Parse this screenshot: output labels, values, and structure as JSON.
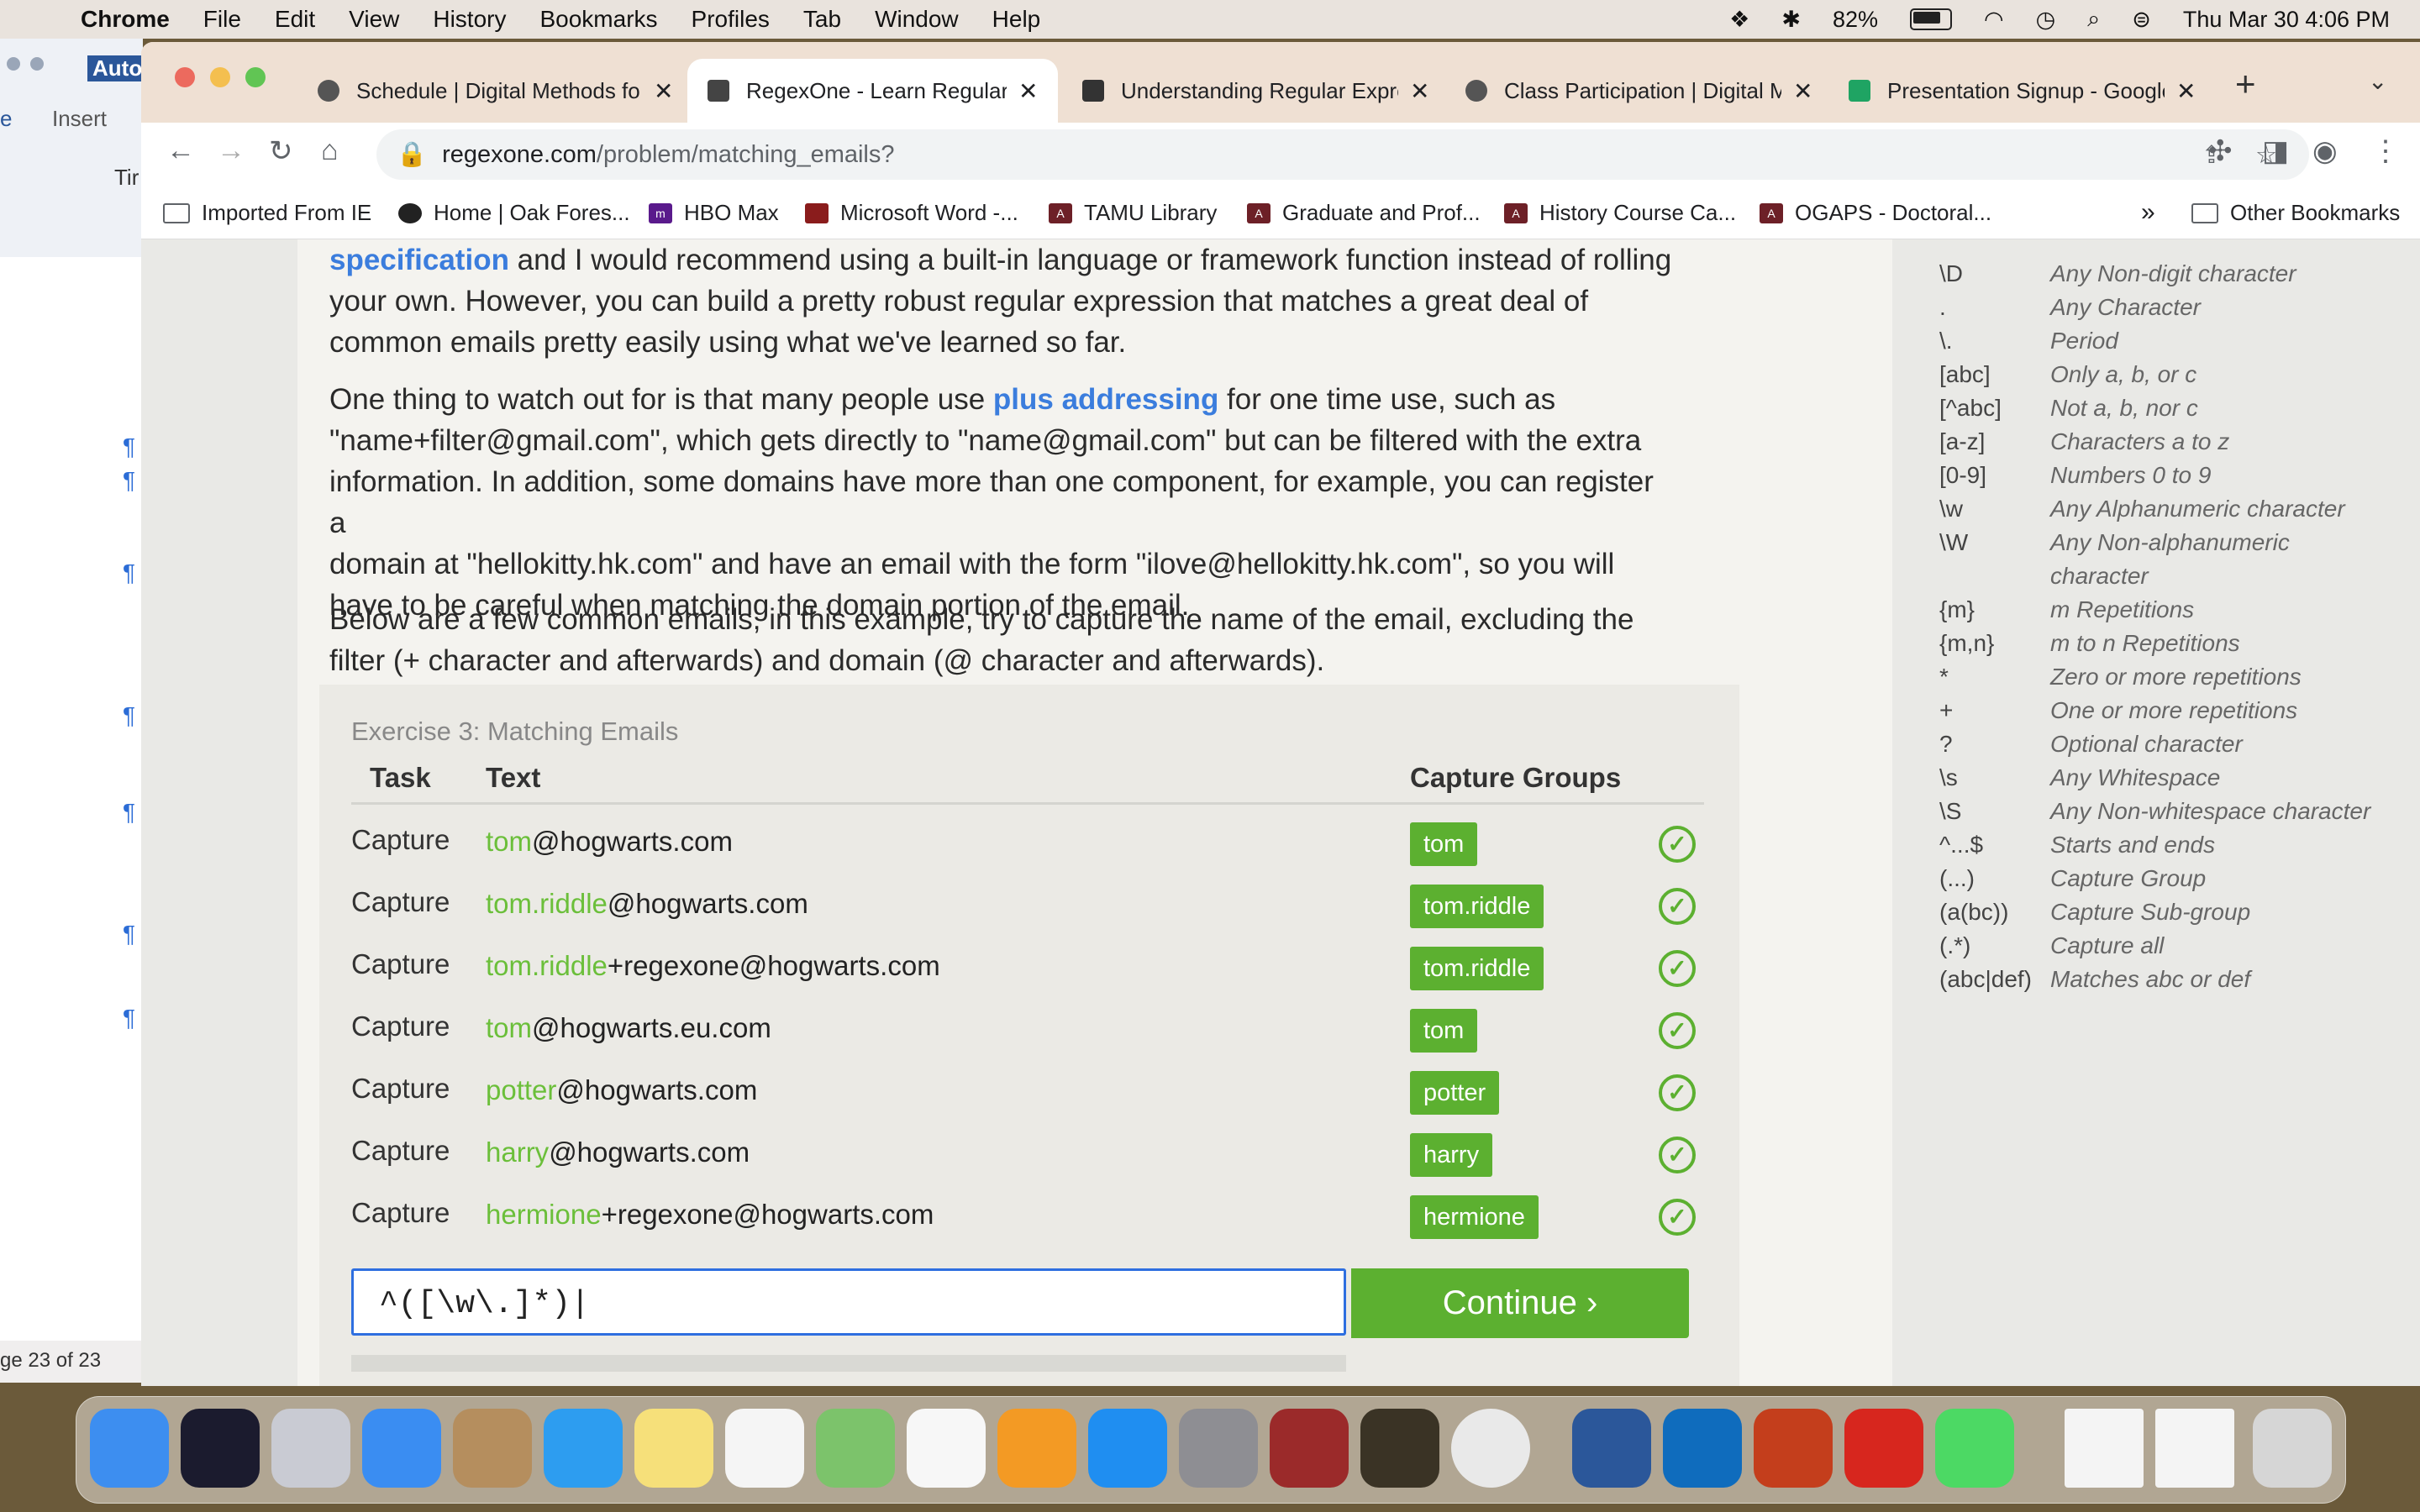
{
  "menubar": {
    "app_name": "Chrome",
    "items": [
      "File",
      "Edit",
      "View",
      "History",
      "Bookmarks",
      "Profiles",
      "Tab",
      "Window",
      "Help"
    ],
    "battery": "82%",
    "datetime": "Thu Mar 30  4:06 PM"
  },
  "word_window": {
    "title": "AutoS",
    "tab_label": "Insert",
    "tab_left": "e",
    "font_field": "Tir",
    "status": "ge 23 of 23"
  },
  "tabs": [
    {
      "title": "Schedule | Digital Methods fo"
    },
    {
      "title": "RegexOne - Learn Regular Ex"
    },
    {
      "title": "Understanding Regular Expre"
    },
    {
      "title": "Class Participation | Digital M"
    },
    {
      "title": "Presentation Signup - Google"
    }
  ],
  "url": {
    "host": "regexone.com",
    "path": "/problem/matching_emails?"
  },
  "bookmarks": [
    "Imported From IE",
    "Home | Oak Fores...",
    "HBO Max",
    "Microsoft Word -...",
    "TAMU Library",
    "Graduate and Prof...",
    "History Course Ca...",
    "OGAPS - Doctoral..."
  ],
  "other_bookmarks": "Other Bookmarks",
  "lesson": {
    "p1_link": "specification",
    "p1_line1": " and I would recommend using a built-in language or framework function instead of rolling",
    "p1_line2": "your own. However, you can build a pretty robust regular expression that matches a great deal of",
    "p1_line3": "common emails pretty easily using what we've learned so far.",
    "p2_pre": "One thing to watch out for is that many people use ",
    "p2_link": "plus addressing",
    "p2_post": " for one time use, such as",
    "p2_line2": "\"name+filter@gmail.com\", which gets directly to \"name@gmail.com\" but can be filtered with the extra",
    "p2_line3": "information. In addition, some domains have more than one component, for example, you can register a",
    "p2_line4": "domain at \"hellokitty.hk.com\" and have an email with the form \"ilove@hellokitty.hk.com\", so you will",
    "p2_line5": "have to be careful when matching the domain portion of the email.",
    "p3_line1": "Below are a few common emails, in this example, try to capture the name of the email, excluding the",
    "p3_line2": "filter (+ character and afterwards) and domain (@ character and afterwards)."
  },
  "exercise": {
    "title": "Exercise 3: Matching Emails",
    "headers": {
      "task": "Task",
      "text": "Text",
      "groups": "Capture Groups"
    },
    "rows": [
      {
        "task": "Capture",
        "match": "tom",
        "rest": "@hogwarts.com",
        "group": "tom"
      },
      {
        "task": "Capture",
        "match": "tom.riddle",
        "rest": "@hogwarts.com",
        "group": "tom.riddle"
      },
      {
        "task": "Capture",
        "match": "tom.riddle",
        "rest": "+regexone@hogwarts.com",
        "group": "tom.riddle"
      },
      {
        "task": "Capture",
        "match": "tom",
        "rest": "@hogwarts.eu.com",
        "group": "tom"
      },
      {
        "task": "Capture",
        "match": "potter",
        "rest": "@hogwarts.com",
        "group": "potter"
      },
      {
        "task": "Capture",
        "match": "harry",
        "rest": "@hogwarts.com",
        "group": "harry"
      },
      {
        "task": "Capture",
        "match": "hermione",
        "rest": "+regexone@hogwarts.com",
        "group": "hermione"
      }
    ],
    "answer": "^([\\w\\.]*)",
    "continue": "Continue ›"
  },
  "cheatsheet": [
    {
      "k": "\\D",
      "v": "Any Non-digit character"
    },
    {
      "k": ".",
      "v": "Any Character"
    },
    {
      "k": "\\.",
      "v": "Period"
    },
    {
      "k": "[abc]",
      "v": "Only a, b, or c"
    },
    {
      "k": "[^abc]",
      "v": "Not a, b, nor c"
    },
    {
      "k": "[a-z]",
      "v": "Characters a to z"
    },
    {
      "k": "[0-9]",
      "v": "Numbers 0 to 9"
    },
    {
      "k": "\\w",
      "v": "Any Alphanumeric character"
    },
    {
      "k": "\\W",
      "v": "Any Non-alphanumeric"
    },
    {
      "k": "",
      "v": "character"
    },
    {
      "k": "{m}",
      "v": "m Repetitions"
    },
    {
      "k": "{m,n}",
      "v": "m to n Repetitions"
    },
    {
      "k": "*",
      "v": "Zero or more repetitions"
    },
    {
      "k": "+",
      "v": "One or more repetitions"
    },
    {
      "k": "?",
      "v": "Optional character"
    },
    {
      "k": "\\s",
      "v": "Any Whitespace"
    },
    {
      "k": "\\S",
      "v": "Any Non-whitespace character"
    },
    {
      "k": "^...$",
      "v": "Starts and ends"
    },
    {
      "k": "(...)",
      "v": "Capture Group"
    },
    {
      "k": "(a(bc))",
      "v": "Capture Sub-group"
    },
    {
      "k": "(.*)",
      "v": "Capture all"
    },
    {
      "k": "(abc|def)",
      "v": "Matches abc or def"
    }
  ],
  "dock": [
    "finder",
    "siri",
    "launchpad",
    "mail",
    "contacts",
    "safari",
    "notes",
    "reminders",
    "maps",
    "photos",
    "books",
    "app-store",
    "system-settings",
    "dictionary",
    "medieval-ii",
    "chrome",
    "word",
    "outlook",
    "powerpoint",
    "acrobat",
    "messages",
    "document-1",
    "document-2",
    "trash"
  ]
}
